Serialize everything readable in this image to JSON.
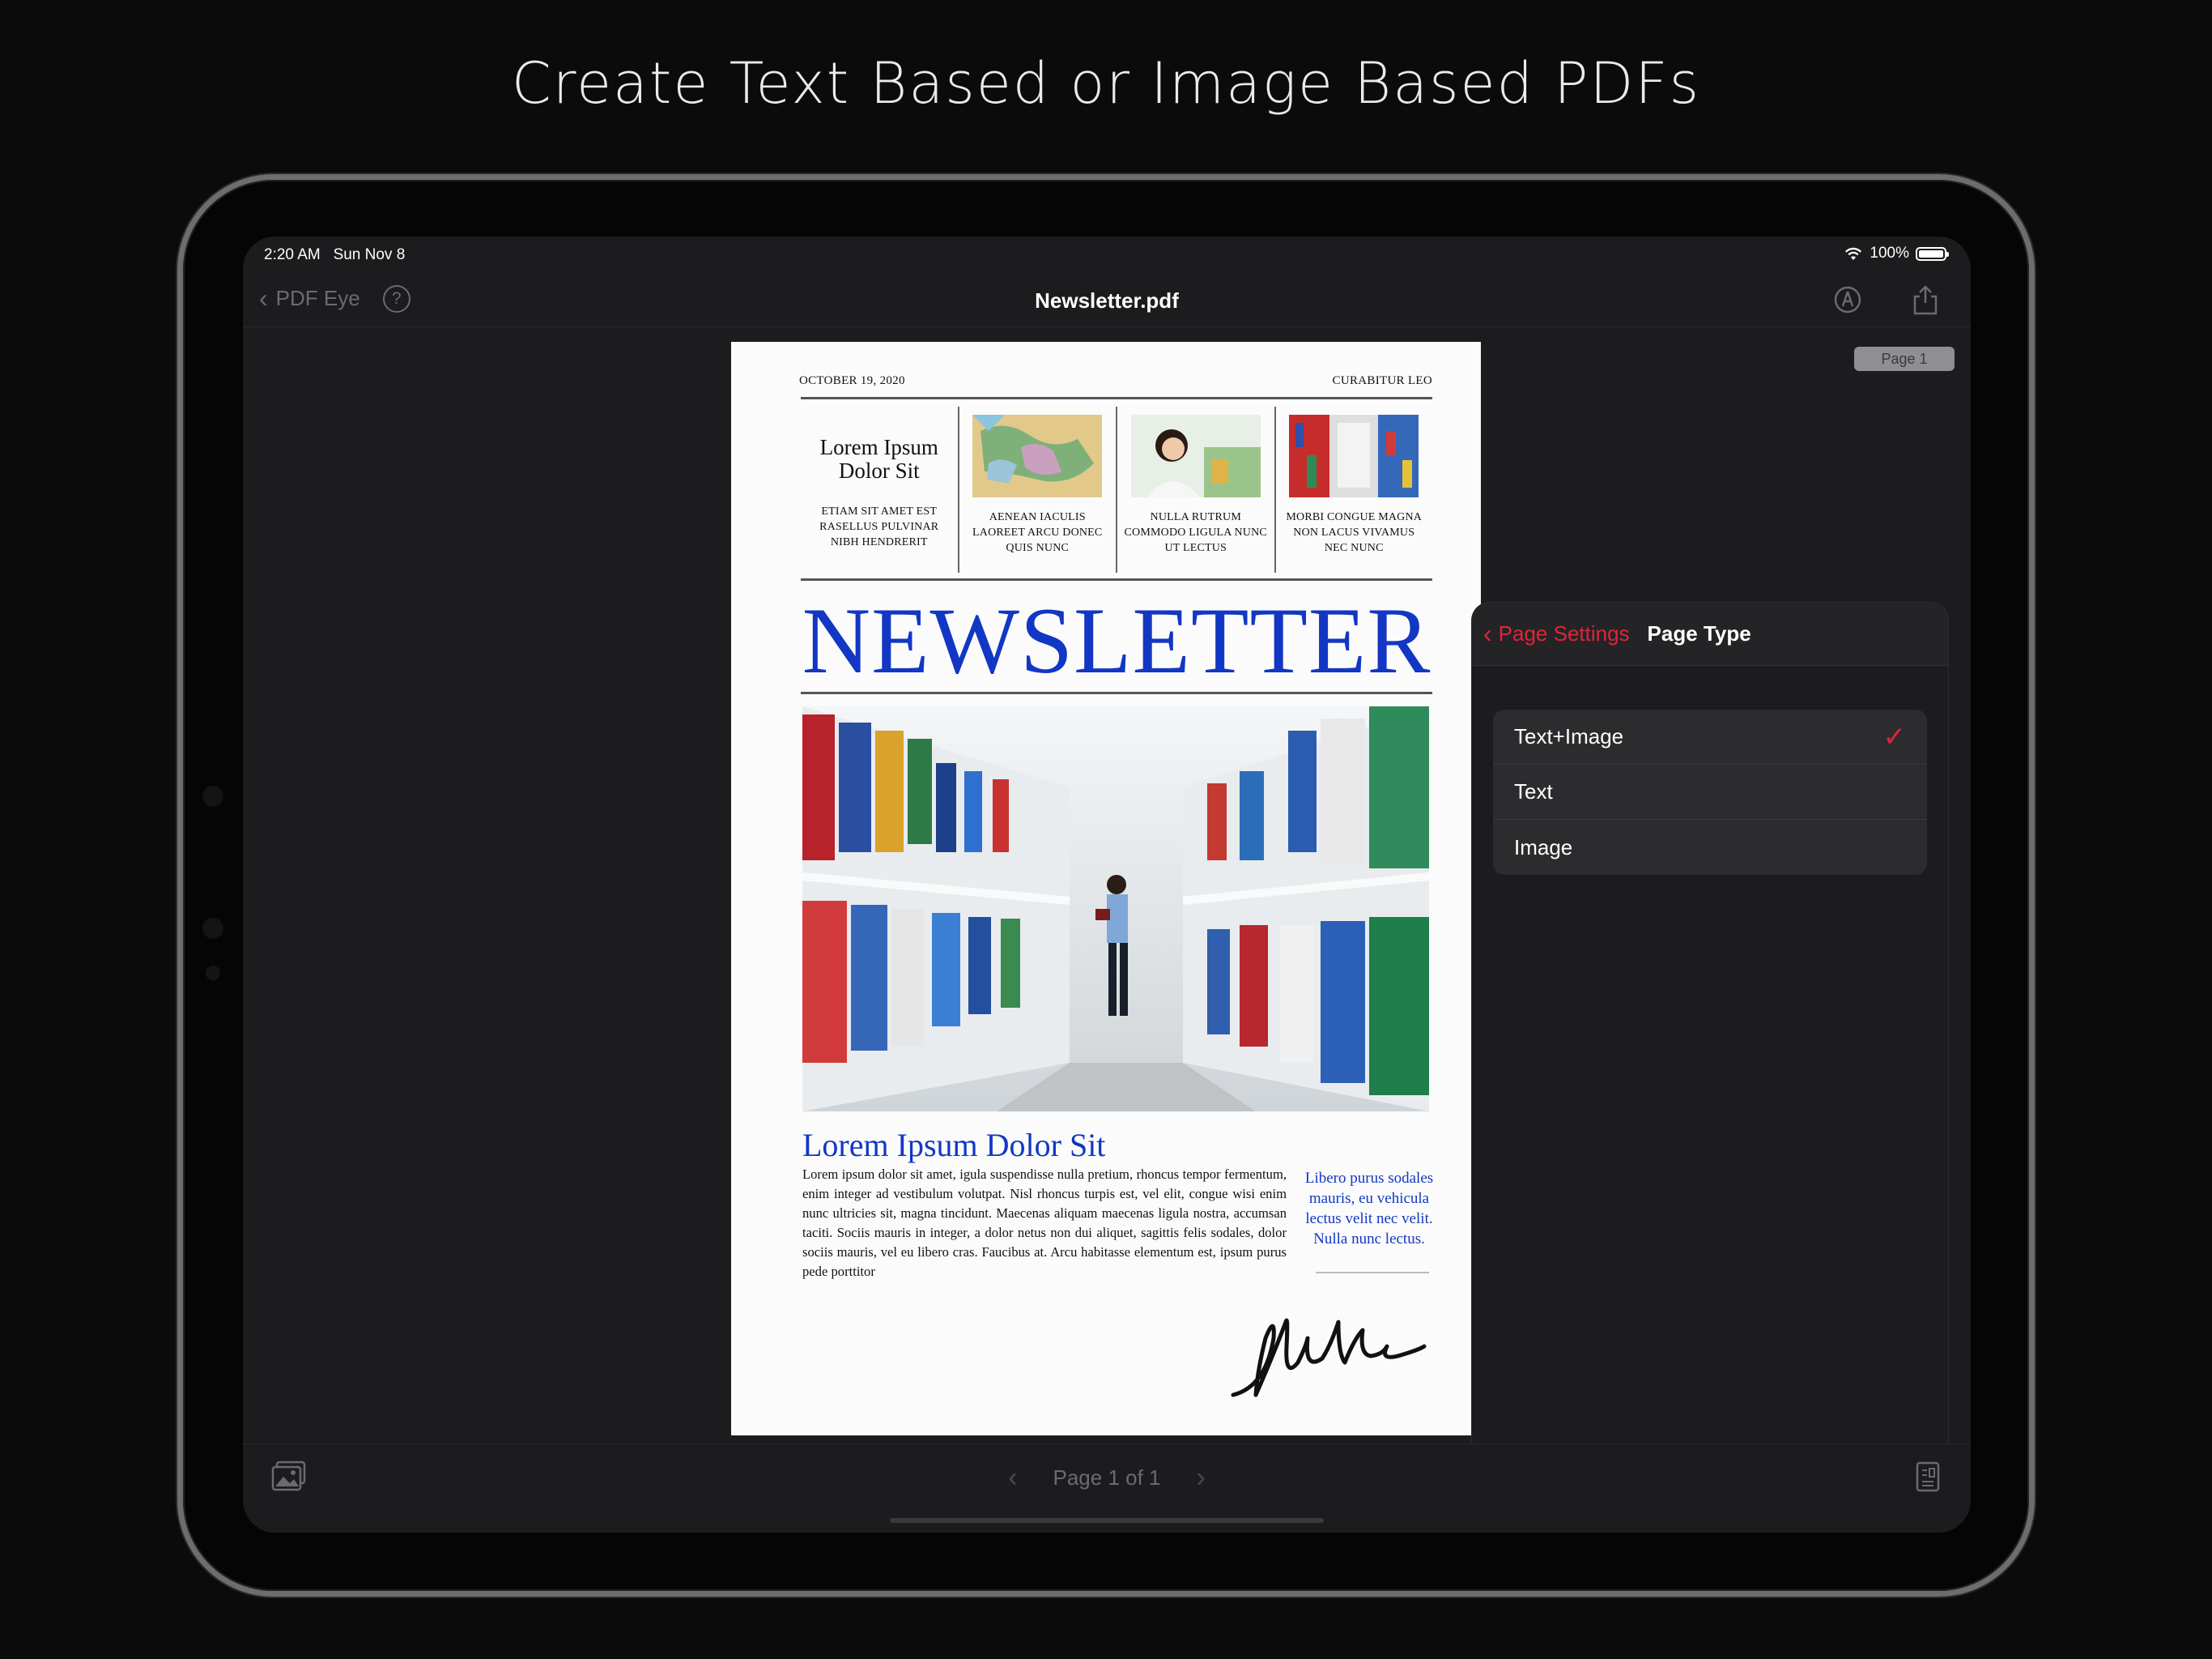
{
  "headline": "Create Text Based or Image Based PDFs",
  "status_bar": {
    "time": "2:20 AM",
    "date": "Sun Nov 8",
    "battery": "100%"
  },
  "nav": {
    "back_label": "PDF Eye",
    "title": "Newsletter.pdf"
  },
  "page_badge": "Page 1",
  "document": {
    "date": "OCTOBER 19, 2020",
    "top_right": "CURABITUR LEO",
    "col1_heading": "Lorem Ipsum Dolor Sit",
    "col1_text": "ETIAM SIT AMET EST RASELLUS PULVINAR NIBH HENDRERIT",
    "col2_text": "AENEAN IACULIS LAOREET ARCU DONEC QUIS NUNC",
    "col3_text": "NULLA RUTRUM COMMODO LIGULA NUNC UT LECTUS",
    "col4_text": "MORBI CONGUE MAGNA NON LACUS VIVAMUS NEC NUNC",
    "masthead": "NEWSLETTER",
    "subheading": "Lorem Ipsum Dolor Sit",
    "body": "Lorem ipsum dolor sit amet, igula suspendisse nulla pretium, rhoncus tempor fermentum, enim integer ad vestibulum volutpat. Nisl rhoncus turpis est, vel elit, congue wisi enim nunc ultricies sit, magna tincidunt. Maecenas aliquam maecenas ligula nostra, accumsan taciti. Sociis mauris in integer, a dolor netus non dui aliquet, sagittis felis sodales, dolor sociis mauris, vel eu libero cras. Faucibus at. Arcu habitasse elementum est, ipsum purus pede porttitor",
    "pull_quote": "Libero purus sodales mauris, eu vehicula lectus velit nec velit. Nulla nunc lectus."
  },
  "popover": {
    "back_label": "Page Settings",
    "title": "Page Type",
    "options": [
      {
        "label": "Text+Image",
        "selected": true
      },
      {
        "label": "Text",
        "selected": false
      },
      {
        "label": "Image",
        "selected": false
      }
    ]
  },
  "toolbar": {
    "pager": "Page 1 of 1"
  },
  "colors": {
    "accent": "#e0243b",
    "masthead": "#1237c4",
    "background": "#1c1c1e"
  }
}
